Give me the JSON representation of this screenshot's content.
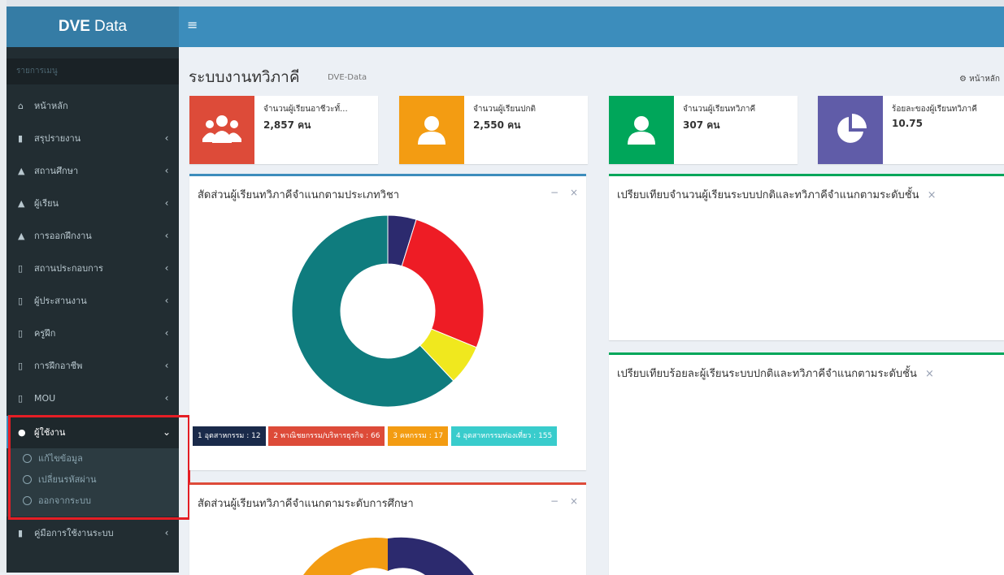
{
  "app": {
    "brand_bold": "DVE",
    "brand_rest": "Data",
    "toggle_icon": "≡"
  },
  "sidebar": {
    "header": "รายการเมนู",
    "items": [
      {
        "label": "หน้าหลัก",
        "icon": "home-icon",
        "chev": ""
      },
      {
        "label": "สรุปรายงาน",
        "icon": "book-icon",
        "chev": "‹"
      },
      {
        "label": "สถานศึกษา",
        "icon": "graduation-cap-icon",
        "chev": "‹"
      },
      {
        "label": "ผู้เรียน",
        "icon": "graduation-cap-icon",
        "chev": "‹"
      },
      {
        "label": "การออกฝึกงาน",
        "icon": "graduation-cap-icon",
        "chev": "‹"
      },
      {
        "label": "สถานประกอบการ",
        "icon": "tablet-icon",
        "chev": "‹"
      },
      {
        "label": "ผู้ประสานงาน",
        "icon": "tablet-icon",
        "chev": "‹"
      },
      {
        "label": "ครูฝึก",
        "icon": "tablet-icon",
        "chev": "‹"
      },
      {
        "label": "การฝึกอาชีพ",
        "icon": "tablet-icon",
        "chev": "‹"
      },
      {
        "label": "MOU",
        "icon": "tablet-icon",
        "chev": "‹"
      },
      {
        "label": "ผู้ใช้งาน",
        "icon": "user-icon",
        "chev": "⌄"
      },
      {
        "label": "คู่มือการใช้งานระบบ",
        "icon": "book-icon",
        "chev": "‹"
      }
    ],
    "submenu": [
      {
        "label": "แก้ไขข้อมูล"
      },
      {
        "label": "เปลี่ยนรหัสผ่าน"
      },
      {
        "label": "ออกจากระบบ"
      }
    ]
  },
  "header": {
    "title": "ระบบงานทวิภาคี",
    "subtitle": "DVE-Data",
    "breadcrumb": "หน้าหลัก"
  },
  "info_boxes": [
    {
      "label": "จำนวนผู้เรียนอาชีวะทั้...",
      "value": "2,857 คน",
      "color": "#dd4b39",
      "icon": "users-icon"
    },
    {
      "label": "จำนวนผู้เรียนปกติ",
      "value": "2,550 คน",
      "color": "#f39c12",
      "icon": "user-icon"
    },
    {
      "label": "จำนวนผู้เรียนทวิภาคี",
      "value": "307 คน",
      "color": "#00a65a",
      "icon": "user-icon"
    },
    {
      "label": "ร้อยละของผู้เรียนทวิภาคี",
      "value": "10.75",
      "color": "#605ca8",
      "icon": "pie-chart-icon"
    }
  ],
  "boxes": {
    "by_type": {
      "title": "สัดส่วนผู้เรียนทวิภาคีจำแนกตามประเภทวิชา",
      "minus": "−",
      "close": "×"
    },
    "compare_count": {
      "title": "เปรียบเทียบจำนวนผู้เรียนระบบปกติและทวิภาคีจำแนกตามระดับชั้น",
      "close": "×"
    },
    "compare_percent": {
      "title": "เปรียบเทียบร้อยละผู้เรียนระบบปกติและทวิภาคีจำแนกตามระดับชั้น",
      "close": "×"
    },
    "by_level": {
      "title": "สัดส่วนผู้เรียนทวิภาคีจำแนกตามระดับการศึกษา",
      "minus": "−",
      "close": "×"
    }
  },
  "chart_data": [
    {
      "type": "pie",
      "labels": [
        "1 อุตสาหกรรม : 12",
        "2 พาณิชยกรรม/บริหารธุรกิจ : 66",
        "3 คหกรรม : 17",
        "4 อุตสาหกรรมท่องเที่ยว : 155"
      ],
      "values": [
        12,
        66,
        17,
        155
      ],
      "colors": [
        "#2c2a6e",
        "#ee1c25",
        "#f0e81e",
        "#0f7c7e"
      ],
      "legend_colors": [
        "#1a2a4a",
        "#dd4b39",
        "#f39c12",
        "#39cccc"
      ]
    }
  ]
}
